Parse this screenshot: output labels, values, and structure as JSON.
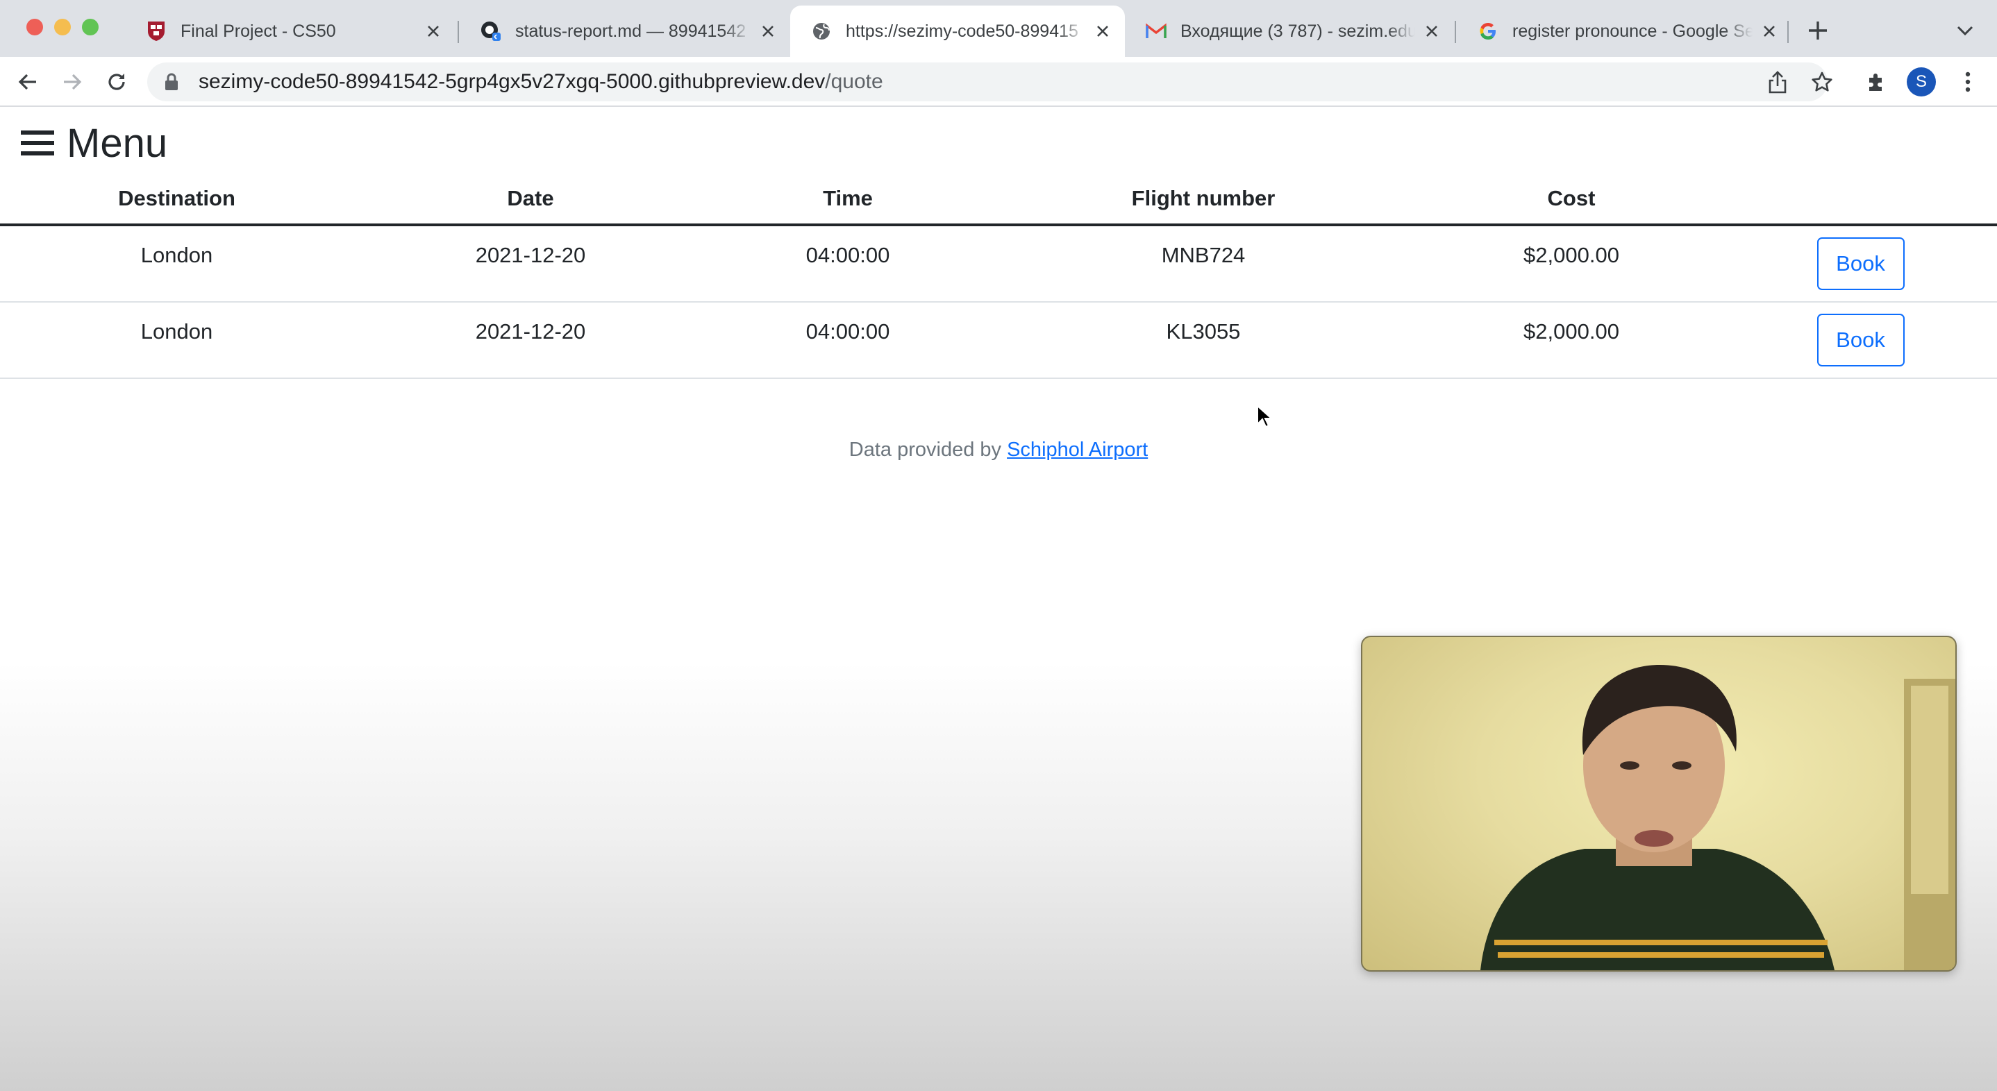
{
  "browser": {
    "tabs": [
      {
        "title": "Final Project - CS50",
        "icon": "harvard-shield-icon",
        "active": false
      },
      {
        "title": "status-report.md — 89941542",
        "icon": "github-codespaces-icon",
        "active": false
      },
      {
        "title": "https://sezimy-code50-899415",
        "icon": "globe-icon",
        "active": true
      },
      {
        "title": "Входящие (3 787) - sezim.edu",
        "icon": "gmail-icon",
        "active": false
      },
      {
        "title": "register pronounce - Google Se",
        "icon": "google-icon",
        "active": false
      }
    ],
    "address": {
      "host": "sezimy-code50-89941542-5grp4gx5v27xgq-5000.githubpreview.dev",
      "path": "/quote"
    },
    "profile_initial": "S"
  },
  "page": {
    "menu_label": "Menu",
    "table": {
      "headers": [
        "Destination",
        "Date",
        "Time",
        "Flight number",
        "Cost"
      ],
      "rows": [
        {
          "destination": "London",
          "date": "2021-12-20",
          "time": "04:00:00",
          "flight": "MNB724",
          "cost": "$2,000.00",
          "action": "Book"
        },
        {
          "destination": "London",
          "date": "2021-12-20",
          "time": "04:00:00",
          "flight": "KL3055",
          "cost": "$2,000.00",
          "action": "Book"
        }
      ]
    },
    "footer": {
      "text": "Data provided by ",
      "link": "Schiphol Airport"
    }
  },
  "colors": {
    "accent": "#0d6efd",
    "tabstrip": "#dee1e6"
  }
}
